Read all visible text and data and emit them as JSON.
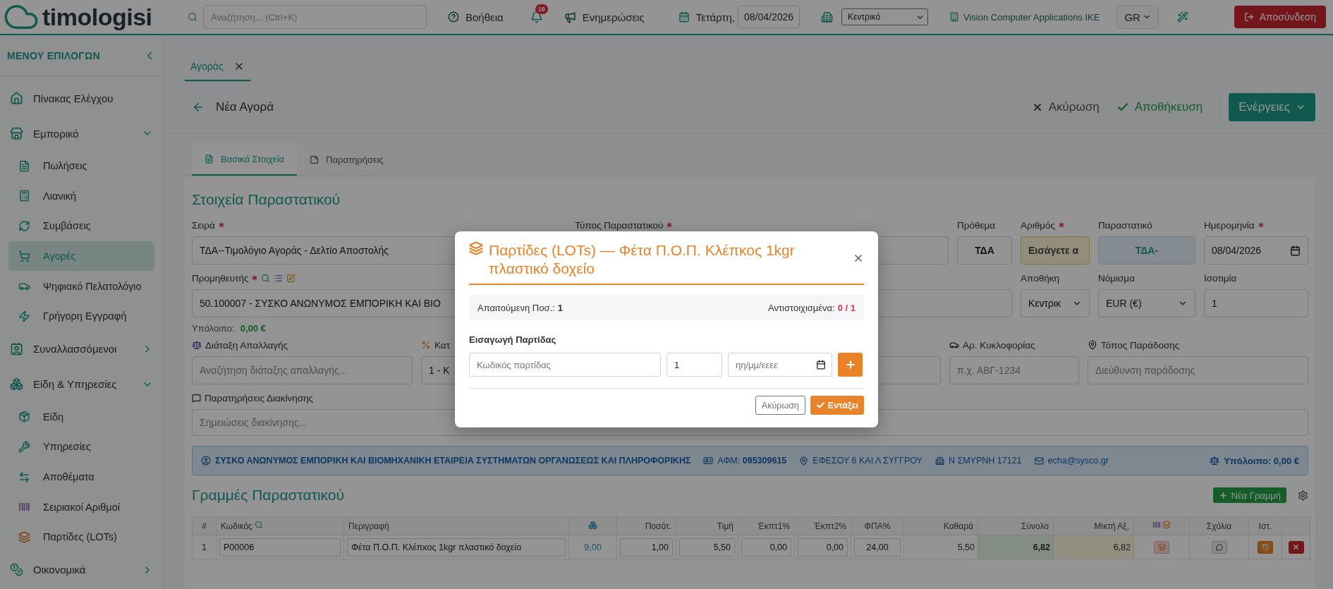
{
  "topbar": {
    "logo": "timologisi",
    "search": {
      "placeholder": "Αναζήτηση... (Ctrl+K)"
    },
    "help": "Βοήθεια",
    "notifications": {
      "count": "19"
    },
    "updates": "Ενημερώσεις",
    "day": "Τετάρτη,",
    "date": "08/04/2026",
    "branch": "Κεντρικό",
    "company": "Vision Computer Applications IKE",
    "language": "GR",
    "logout": "Αποσύνδεση"
  },
  "sidebar": {
    "title": "ΜΕΝΟΥ ΕΠΙΛΟΓΩΝ",
    "items": [
      {
        "label": "Πίνακας Ελέγχου",
        "kind": "link",
        "selected": false
      },
      {
        "label": "Εμπορικό",
        "kind": "group",
        "expanded": true,
        "selected": false,
        "children": [
          {
            "label": "Πωλήσεις",
            "selected": false
          },
          {
            "label": "Λιανική",
            "selected": false
          },
          {
            "label": "Συμβάσεις",
            "selected": false
          },
          {
            "label": "Αγορές",
            "selected": true
          },
          {
            "label": "Ψηφιακό Πελατολόγιο",
            "selected": false
          },
          {
            "label": "Γρήγορη Εγγραφή",
            "selected": false
          }
        ]
      },
      {
        "label": "Συναλλασσόμενοι",
        "kind": "group",
        "expanded": false,
        "selected": false
      },
      {
        "label": "Είδη & Υπηρεσίες",
        "kind": "group",
        "expanded": true,
        "selected": false,
        "children": [
          {
            "label": "Είδη",
            "selected": false
          },
          {
            "label": "Υπηρεσίες",
            "selected": false
          },
          {
            "label": "Αποθέματα",
            "selected": false
          },
          {
            "label": "Σειριακοί Αριθμοί",
            "selected": false
          },
          {
            "label": "Παρτίδες (LOTs)",
            "selected": false
          }
        ]
      },
      {
        "label": "Οικονομικά",
        "kind": "group",
        "expanded": false,
        "selected": false
      }
    ]
  },
  "doc_tabs": [
    {
      "label": "Αγοράς",
      "selected": true
    }
  ],
  "header": {
    "title": "Νέα Αγορά",
    "cancel": "Ακύρωση",
    "save": "Αποθήκευση",
    "actions": "Ενέργειες"
  },
  "form_tabs": [
    {
      "label": "Βασικά Στοιχεία",
      "selected": true
    },
    {
      "label": "Παρατηρήσεις",
      "selected": false
    }
  ],
  "section_title": "Στοιχεία Παραστατικού",
  "row1": [
    {
      "label": "Σειρά",
      "required": true,
      "kind": "text",
      "value": "ΤΔΑ--Τιμολόγιο Αγοράς - Δελτίο Αποστολής"
    },
    {
      "label": "Τύπος Παραστατικού",
      "required": true,
      "kind": "text"
    },
    {
      "label": "Πρόθεμα",
      "required": false,
      "kind": "center",
      "value": "ΤΔΑ"
    },
    {
      "label": "Αριθμός",
      "required": true,
      "kind": "highlight",
      "placeholder": "Εισάγετε α"
    },
    {
      "label": "Παραστατικό",
      "required": false,
      "kind": "info",
      "value": "ΤΔΑ-"
    },
    {
      "label": "Ημερομηνία",
      "required": true,
      "kind": "date",
      "value": "08/04/2026"
    }
  ],
  "row2": [
    {
      "label": "Προμηθευτής",
      "required": true,
      "kind": "supplier",
      "value": "50.100007 - ΣΥΣΚΟ ΑΝΩΝΥΜΟΣ ΕΜΠΟΡΙΚΗ ΚΑΙ ΒΙΟ"
    },
    {
      "label": "Αποθήκη",
      "required": false,
      "kind": "select",
      "value": "Κεντρικ"
    },
    {
      "label": "Νόμισμα",
      "required": false,
      "kind": "select",
      "value": "EUR (€)"
    },
    {
      "label": "Ισοτιμία",
      "required": false,
      "kind": "text",
      "value": "1"
    }
  ],
  "balance": {
    "label": "Υπόλοιπο:",
    "value": "0,00 €"
  },
  "row3": [
    {
      "label": "Διάταξη Απαλλαγής",
      "kind": "text",
      "placeholder": "Αναζήτηση διάταξης απαλλαγής..."
    },
    {
      "label": "Κατ",
      "kind": "select",
      "value": "1 - Κ"
    },
    {
      "kind": "select"
    },
    {
      "label": "Αρ. Κυκλοφορίας",
      "kind": "text",
      "placeholder": "π.χ. ΑΒΓ-1234"
    },
    {
      "label": "Τόπος Παράδοσης",
      "kind": "text",
      "placeholder": "Διεύθυνση παράδοσης"
    }
  ],
  "notes": {
    "label": "Παρατηρήσεις Διακίνησης",
    "placeholder": "Σημειώσεις διακίνησης..."
  },
  "info_bar": {
    "name": "ΣΥΣΚΟ ΑΝΩΝΥΜΟΣ ΕΜΠΟΡΙΚΗ ΚΑΙ ΒΙΟΜΗΧΑΝΙΚΗ ΕΤΑΙΡΕΙΑ ΣΥΣΤΗΜΑΤΩΝ ΟΡΓΑΝΩΣΕΩΣ ΚΑΙ ΠΛΗΡΟΦΟΡΙΚΗΣ",
    "vat": "ΑΦΜ: **095309615**",
    "address": "ΕΦΕΣΟΥ 6 ΚΑΙ Λ ΣΥΓΓΡΟΥ",
    "city": "Ν ΣΜΥΡΝΗ 17121",
    "email": "echa@sysco.gr",
    "balance": "Υπόλοιπο: 0,00 €"
  },
  "lines": {
    "title": "Γραμμές Παραστατικού",
    "new_line": "Νέα Γραμμή",
    "columns": [
      {
        "label": "#"
      },
      {
        "label": "Κωδικός"
      },
      {
        "label": "Περιγραφή"
      },
      {},
      {
        "label": "Ποσότ."
      },
      {
        "label": "Τιμή"
      },
      {
        "label": "Έκπτ1%"
      },
      {
        "label": "Έκπτ2%"
      },
      {
        "label": "ΦΠΑ%"
      },
      {
        "label": "Καθαρά"
      },
      {
        "label": "Σύνολο"
      },
      {
        "label": "Μικτή Αξ."
      },
      {},
      {
        "label": "Σχόλια"
      },
      {
        "label": "Ιστ."
      },
      {}
    ],
    "rows": [
      {
        "number": "1",
        "code": "P00006",
        "description": "Φέτα Π.Ο.Π. Κλέπκος 1kgr πλαστικό δοχείο",
        "stock": "9,00",
        "quantity": "1,00",
        "price": "5,50",
        "discount1": "0,00",
        "discount2": "0,00",
        "vat": "24,00",
        "net": "5,50",
        "total": "6,82",
        "gross": "6,82"
      }
    ]
  },
  "modal": {
    "title": "Παρτίδες (LOTs) — Φέτα Π.Ο.Π. Κλέπκος 1kgr πλαστικό δοχείο",
    "required_label": "Απαιτούμενη Ποσ.:",
    "required_qty": "1",
    "matched_label": "Αντιστοιχισμένα:",
    "matched": "0 / 1",
    "entry_title": "Εισαγωγή Παρτίδας",
    "lot_placeholder": "Κωδικός παρτίδας",
    "qty": "1",
    "date_placeholder": "ηη/μμ/εεεε",
    "cancel": "Ακύρωση",
    "ok": "Εντάξει"
  }
}
